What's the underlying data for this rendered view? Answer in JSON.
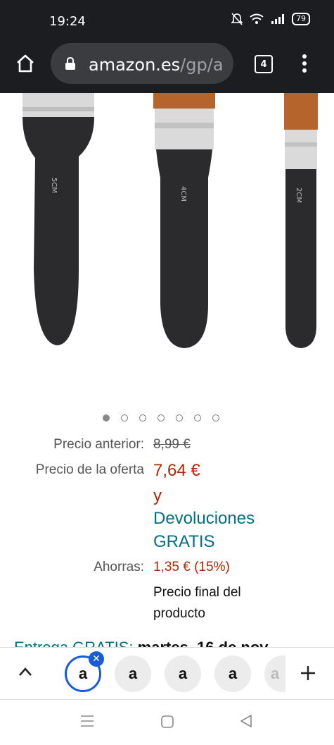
{
  "status_bar": {
    "time": "19:24",
    "battery": "79"
  },
  "browser": {
    "url_domain": "amazon.es",
    "url_path": "/gp/a",
    "tab_count": "4"
  },
  "product_images": {
    "brushes": [
      {
        "label": "5CM"
      },
      {
        "label": "4CM"
      },
      {
        "label": "2CM"
      }
    ],
    "carousel_dot_count": 7,
    "carousel_active_index": 0
  },
  "pricing": {
    "previous_label": "Precio anterior:",
    "previous_value": "8,99 €",
    "offer_label": "Precio de la oferta",
    "offer_value": "7,64 €",
    "offer_connector": "y",
    "returns_line1": "Devoluciones",
    "returns_line2": "GRATIS",
    "savings_label": "Ahorras:",
    "savings_value": "1,35 € (15%)",
    "final_line1": "Precio final del",
    "final_line2": "producto"
  },
  "delivery_partial": {
    "link": "Entrega GRATIS:",
    "date": "martes, 16 de nov"
  },
  "tab_strip": {
    "tabs": [
      {
        "letter": "a"
      },
      {
        "letter": "a"
      },
      {
        "letter": "a"
      },
      {
        "letter": "a"
      },
      {
        "letter": "a"
      }
    ]
  }
}
